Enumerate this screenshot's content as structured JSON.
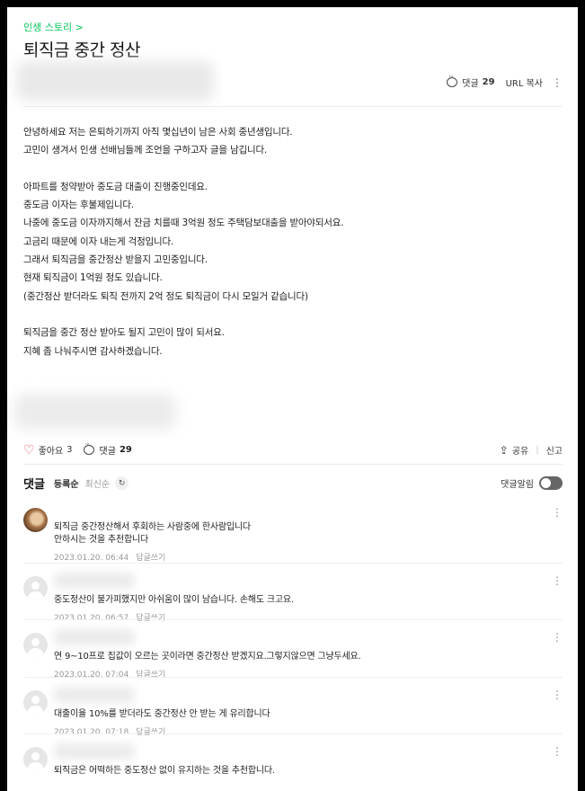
{
  "post": {
    "category": "인생 스토리 >",
    "title": "퇴직금 중간 정산",
    "comment_label": "댓글",
    "comment_count": "29",
    "url_copy": "URL 복사",
    "more": "⋮",
    "body_lines": [
      "안녕하세요 저는 은퇴하기까지 아직 몇십년이 남은 사회 중년생입니다.",
      "고민이 생겨서 인생 선배님들께 조언을 구하고자 글을 남깁니다.",
      "",
      "아파트를 청약받아 중도금 대출이 진행중인데요.",
      "중도금 이자는 후불제입니다.",
      "나중에 중도금 이자까지해서 잔금 치를때 3억원 정도 주택담보대출을 받아야되서요.",
      "고금리 때문에 이자 내는게 걱정입니다.",
      "그래서 퇴직금을 중간정산 받을지 고민중입니다.",
      "현재 퇴직금이 1억원 정도 있습니다.",
      "(중간정산 받더라도 퇴직 전까지 2억 정도 퇴직금이 다시 모일거 같습니다)",
      "",
      "퇴직금을 중간 정산 받아도 될지 고민이 많이 되서요.",
      "지혜 좀 나눠주시면 감사하겠습니다."
    ]
  },
  "actions": {
    "like_label": "좋아요",
    "like_count": "3",
    "comment_label": "댓글",
    "comment_count": "29",
    "share_label": "공유",
    "report_label": "신고"
  },
  "comments_section": {
    "title": "댓글",
    "sort_registered": "등록순",
    "sort_latest": "최신순",
    "refresh_icon": "↻",
    "notify_label": "댓글알림",
    "notify_on": false
  },
  "comments": [
    {
      "avatar": "photo",
      "lines": [
        "퇴직금 중간정산해서 후회하는 사람중에 한사람입니다",
        "안하시는 것을 추천합니다"
      ],
      "date": "2023.01.20. 06:44",
      "reply_label": "답글쓰기"
    },
    {
      "avatar": "default",
      "lines": [
        "중도정산이 불가피했지만 아쉬움이 많이 남습니다. 손해도 크고요."
      ],
      "date": "2023.01.20. 06:57",
      "reply_label": "답글쓰기"
    },
    {
      "avatar": "default",
      "lines": [
        "연 9~10프로 집값이 오르는 곳이라면 중간정산 받겠지요.그렇지않으면 그냥두세요."
      ],
      "date": "2023.01.20. 07:04",
      "reply_label": "답글쓰기"
    },
    {
      "avatar": "default",
      "lines": [
        "대출이율 10%를 받더라도 중간정산 안 받는 게 유리합니다"
      ],
      "date": "2023.01.20. 07:18",
      "reply_label": "답글쓰기"
    },
    {
      "avatar": "default",
      "lines": [
        "퇴직금은 어떡하든 중도정산 없이 유지하는 것을 추천합니다."
      ],
      "date": "",
      "reply_label": ""
    }
  ]
}
